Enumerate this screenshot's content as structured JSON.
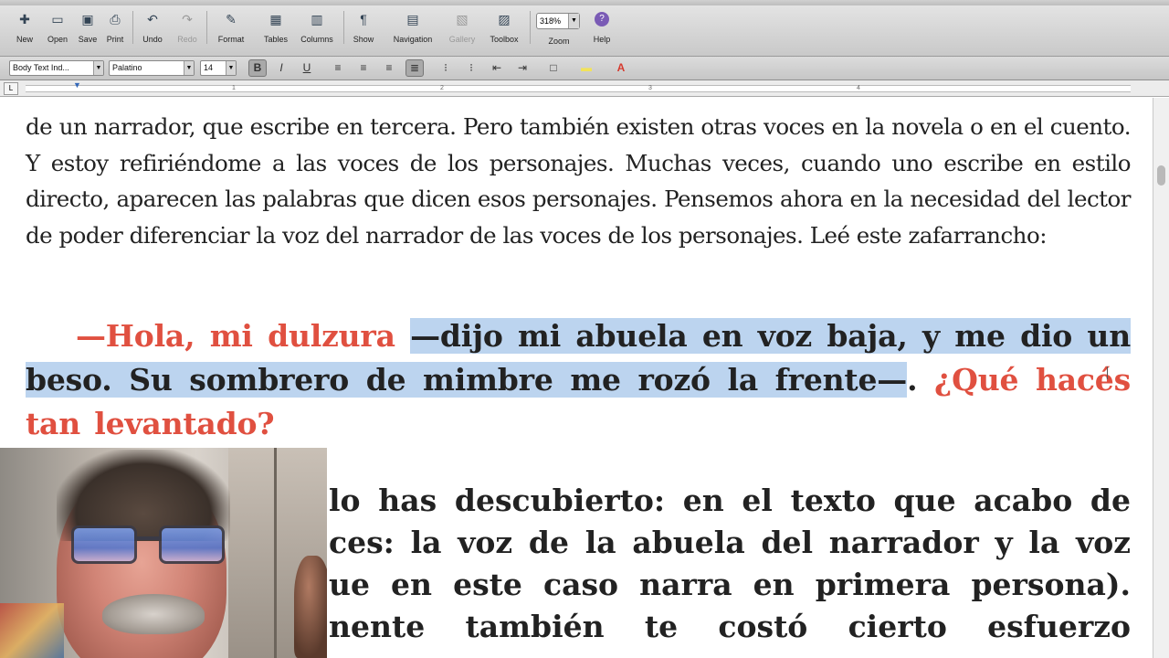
{
  "toolbar": {
    "buttons": [
      {
        "label": "New",
        "icon": "new-document-icon",
        "glyph": "✚"
      },
      {
        "label": "Open",
        "icon": "open-folder-icon",
        "glyph": "▭"
      },
      {
        "label": "Save",
        "icon": "save-disk-icon",
        "glyph": "▣"
      },
      {
        "label": "Print",
        "icon": "printer-icon",
        "glyph": "⎙"
      },
      {
        "label": "Undo",
        "icon": "undo-icon",
        "glyph": "↶"
      },
      {
        "label": "Redo",
        "icon": "redo-icon",
        "glyph": "↷"
      },
      {
        "label": "Format",
        "icon": "format-brush-icon",
        "glyph": "✎"
      },
      {
        "label": "Tables",
        "icon": "table-grid-icon",
        "glyph": "▦"
      },
      {
        "label": "Columns",
        "icon": "columns-icon",
        "glyph": "▥"
      },
      {
        "label": "Show",
        "icon": "pilcrow-icon",
        "glyph": "¶"
      },
      {
        "label": "Navigation",
        "icon": "navigation-pane-icon",
        "glyph": "▤"
      },
      {
        "label": "Gallery",
        "icon": "gallery-icon",
        "glyph": "▧"
      },
      {
        "label": "Toolbox",
        "icon": "toolbox-icon",
        "glyph": "▨"
      },
      {
        "label": "Zoom",
        "icon": "zoom-select-icon",
        "glyph": ""
      },
      {
        "label": "Help",
        "icon": "help-question-icon",
        "glyph": "?"
      }
    ],
    "zoom_value": "318%"
  },
  "formatbar": {
    "style_value": "Body Text Ind...",
    "font_value": "Palatino",
    "size_value": "14",
    "buttons": [
      {
        "glyph": "B",
        "icon": "bold-icon"
      },
      {
        "glyph": "I",
        "icon": "italic-icon"
      },
      {
        "glyph": "U",
        "icon": "underline-icon"
      },
      {
        "glyph": "≡",
        "icon": "align-left-icon"
      },
      {
        "glyph": "≡",
        "icon": "align-center-icon"
      },
      {
        "glyph": "≡",
        "icon": "align-right-icon"
      },
      {
        "glyph": "≣",
        "icon": "justify-icon"
      },
      {
        "glyph": "⁝",
        "icon": "numbered-list-icon"
      },
      {
        "glyph": "⁝",
        "icon": "bullet-list-icon"
      },
      {
        "glyph": "⇤",
        "icon": "decrease-indent-icon"
      },
      {
        "glyph": "⇥",
        "icon": "increase-indent-icon"
      },
      {
        "glyph": "□",
        "icon": "borders-icon"
      },
      {
        "glyph": "▬",
        "icon": "highlight-color-icon"
      },
      {
        "glyph": "A",
        "icon": "font-color-icon"
      }
    ],
    "colors": {
      "highlight": "#f2e35a",
      "font_color": "#d63a2e"
    }
  },
  "ruler": {
    "numbers": [
      "1",
      "2",
      "3",
      "4"
    ]
  },
  "document": {
    "para1": "de un narrador, que escribe en tercera. Pero también existen otras voces en la novela o en el cuento. Y estoy refiriéndome a las voces de los personajes. Muchas veces, cuando uno escribe en estilo directo, aparecen las palabras que dicen esos personajes. Pensemos ahora en la necesidad del lector de poder diferenciar la voz del narrador de las voces de los personajes. Leé este zafarrancho:",
    "para2_red1": "—Hola, mi dulzura ",
    "para2_highlighted": "—dijo mi abuela en voz baja, y me dio un beso. Su sombrero de mimbre me rozó la frente—",
    "para2_end": ".",
    "para2_red2": "¿Qué hacés tan levantado?",
    "para3_lines": [
      "lo has descubierto: en el texto que acabo de",
      "ces: la voz de la abuela del narrador y la voz",
      "ue en este caso narra en primera persona).",
      "nente también te costó cierto esfuerzo"
    ],
    "colors": {
      "dialogue_red": "#e05040",
      "selection": "#bcd4ef"
    }
  }
}
